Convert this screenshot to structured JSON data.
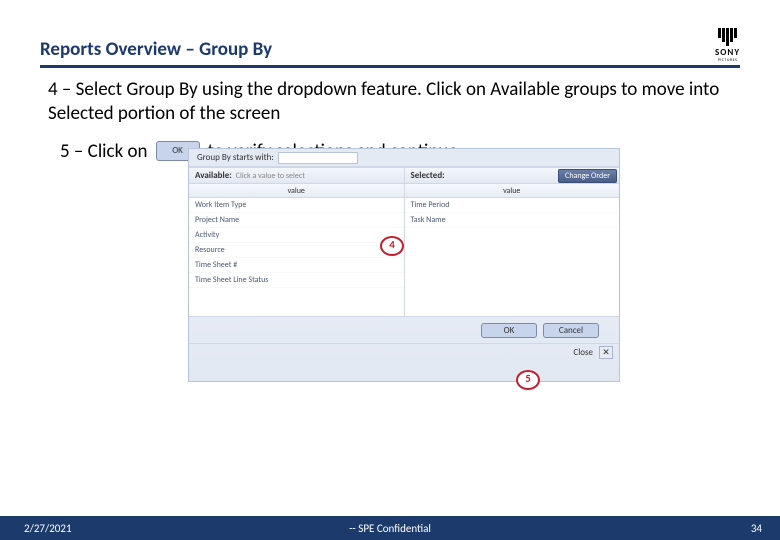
{
  "header": {
    "title": "Reports Overview – Group By"
  },
  "logo": {
    "text": "SONY",
    "sub": "PICTURES"
  },
  "step4": "4 – Select Group By using the dropdown feature.  Click on Available groups to move into Selected portion of the screen",
  "step5a": "5 – Click on",
  "step5b": "to verify selections and continue",
  "okSmall": "OK",
  "app": {
    "startsLabel": "Group By starts with:",
    "availableLabel": "Available:",
    "availableHint": "Click a value to select",
    "selectedLabel": "Selected:",
    "changeOrder": "Change Order",
    "valueHeader": "value",
    "available": [
      "Work Item Type",
      "Project Name",
      "Activity",
      "Resource",
      "Time Sheet #",
      "Time Sheet Line Status"
    ],
    "selected": [
      "Time Period",
      "Task Name"
    ],
    "okBtn": "OK",
    "cancelBtn": "Cancel",
    "closeLabel": "Close",
    "closeX": "✕"
  },
  "callouts": {
    "c4": "4",
    "c5": "5"
  },
  "footer": {
    "date": "2/27/2021",
    "conf": "-- SPE Confidential",
    "page": "34"
  }
}
